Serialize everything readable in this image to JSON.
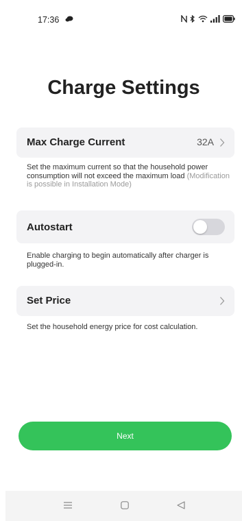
{
  "status_bar": {
    "time": "17:36",
    "icons": [
      "chat-bubble-icon",
      "nfc-icon",
      "bluetooth-icon",
      "wifi-icon",
      "signal-icon",
      "battery-icon"
    ]
  },
  "page": {
    "title": "Charge Settings"
  },
  "settings": {
    "max_current": {
      "label": "Max Charge Current",
      "value": "32A",
      "description": "Set the maximum current so that the household power consumption will not exceed the maximum load",
      "note": "(Modification is possible in Installation Mode)"
    },
    "autostart": {
      "label": "Autostart",
      "enabled": false,
      "description": "Enable charging to begin automatically after charger is plugged-in."
    },
    "set_price": {
      "label": "Set Price",
      "description": "Set the household energy price for cost calculation."
    }
  },
  "actions": {
    "next_label": "Next"
  },
  "nav_bar": {
    "icons": [
      "menu-icon",
      "home-icon",
      "back-icon"
    ]
  },
  "colors": {
    "accent": "#34c35a",
    "row_background": "#f3f3f5",
    "toggle_off": "#d7d7dc"
  }
}
